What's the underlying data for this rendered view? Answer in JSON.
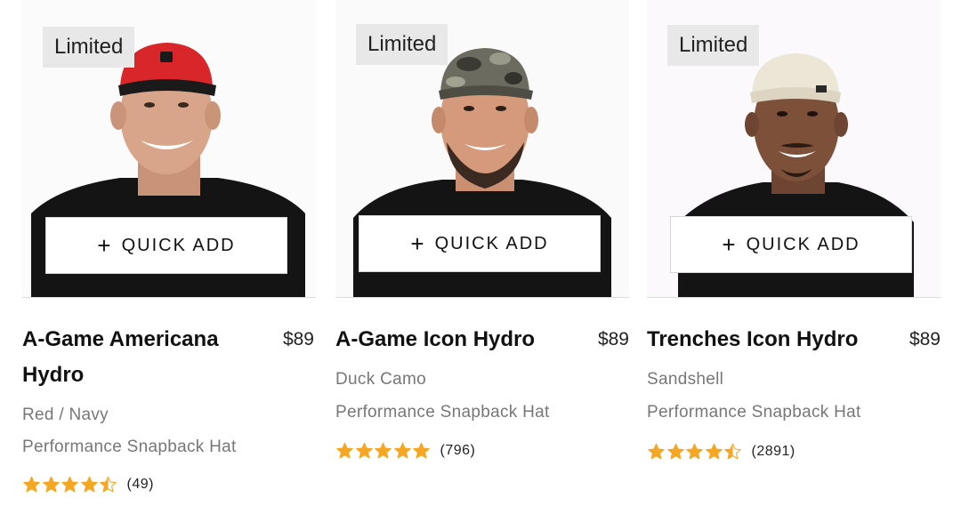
{
  "products": [
    {
      "badge": "Limited",
      "quick_add": "QUICK ADD",
      "name": "A-Game Americana Hydro",
      "price": "$89",
      "color": "Red / Navy",
      "type": "Performance Snapback Hat",
      "rating": 4.5,
      "reviews": "(49)",
      "cap_color": "#d8262a",
      "brim_color": "#1a1a1a"
    },
    {
      "badge": "Limited",
      "quick_add": "QUICK ADD",
      "name": "A-Game Icon Hydro",
      "price": "$89",
      "color": "Duck Camo",
      "type": "Performance Snapback Hat",
      "rating": 5,
      "reviews": "(796)",
      "cap_color": "#6b6b5f",
      "brim_color": "#4d4d44"
    },
    {
      "badge": "Limited",
      "quick_add": "QUICK ADD",
      "name": "Trenches Icon Hydro",
      "price": "$89",
      "color": "Sandshell",
      "type": "Performance Snapback Hat",
      "rating": 4.5,
      "reviews": "(2891)",
      "cap_color": "#ece6d6",
      "brim_color": "#ddd5c2"
    }
  ],
  "colors": {
    "star": "#f5a623",
    "badge_bg": "#e8e8e8",
    "muted_text": "#777777"
  }
}
